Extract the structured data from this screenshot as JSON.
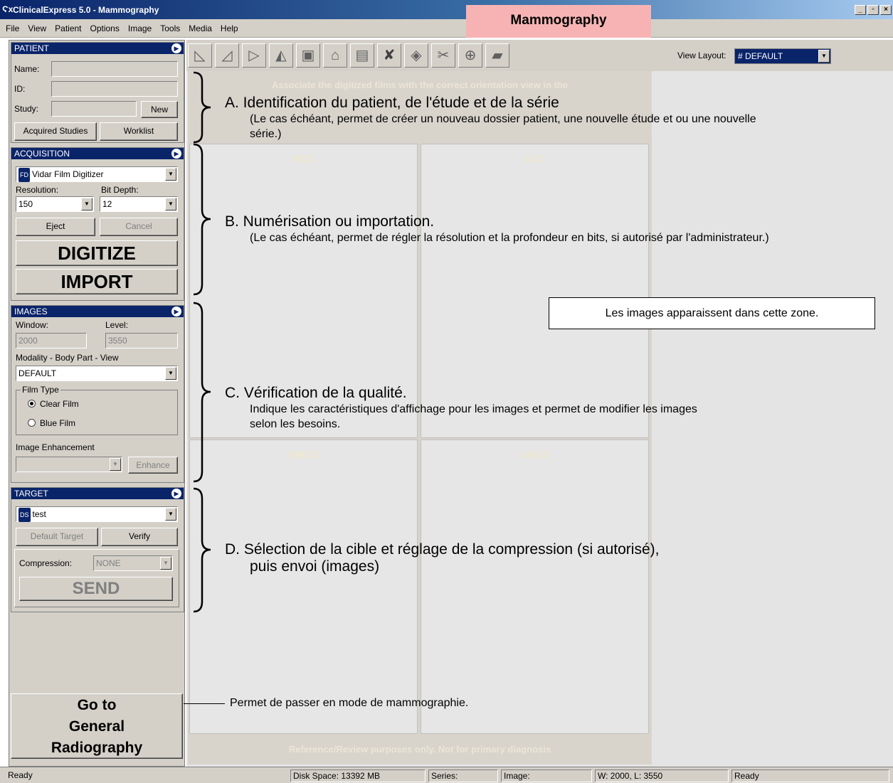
{
  "window": {
    "icon": "Ϛx",
    "title": "ClinicalExpress 5.0 - Mammography",
    "min": "_",
    "max": "▫",
    "close": "×"
  },
  "menu": [
    "File",
    "View",
    "Patient",
    "Options",
    "Image",
    "Tools",
    "Media",
    "Help"
  ],
  "mode_banner": "Mammography",
  "patient": {
    "header": "PATIENT",
    "name_label": "Name:",
    "id_label": "ID:",
    "study_label": "Study:",
    "new_button": "New",
    "acquired_button": "Acquired Studies",
    "worklist_button": "Worklist"
  },
  "acquisition": {
    "header": "ACQUISITION",
    "device_badge": "FD",
    "device": "Vidar Film Digitizer",
    "resolution_label": "Resolution:",
    "bitdepth_label": "Bit Depth:",
    "resolution": "150",
    "bitdepth": "12",
    "eject_button": "Eject",
    "cancel_button": "Cancel",
    "digitize_button": "DIGITIZE",
    "import_button": "IMPORT"
  },
  "images": {
    "header": "IMAGES",
    "window_label": "Window:",
    "level_label": "Level:",
    "window_value": "2000",
    "level_value": "3550",
    "modality_label": "Modality - Body Part - View",
    "modality_value": "DEFAULT",
    "filmtype_label": "Film Type",
    "clear_film": "Clear Film",
    "blue_film": "Blue Film",
    "enhancement_label": "Image Enhancement",
    "enhance_button": "Enhance"
  },
  "target": {
    "header": "TARGET",
    "target_badge": "DS",
    "target_value": "test",
    "default_target_button": "Default Target",
    "verify_button": "Verify",
    "compression_label": "Compression:",
    "compression_value": "NONE",
    "send_button": "SEND"
  },
  "goto_button": {
    "line1": "Go to",
    "line2": "General",
    "line3": "Radiography"
  },
  "toolbar": {
    "view_layout_label": "View Layout:",
    "view_layout_value": "DEFAULT",
    "tools": [
      "flip-left-icon",
      "flip-right-icon",
      "play-icon",
      "mirror-icon",
      "fit-icon",
      "home-icon",
      "page-icon",
      "delete-icon",
      "fill-icon",
      "cut-icon",
      "zoom-icon",
      "chat-icon"
    ]
  },
  "hanger": {
    "top_note_1": "Associate the digitized films with the correct orientation view in the",
    "vp_rcc": "RCC",
    "vp_lcc": "LCC",
    "vp_rmlo": "RMLO",
    "vp_lmlo": "LMLO",
    "bottom_note": "Reference/Review purposes only. Not for primary diagnosis"
  },
  "annotations": {
    "a_head": "A. Identification du patient, de l'étude et de la série",
    "a_sub": "(Le cas échéant, permet de créer un nouveau dossier patient, une nouvelle étude et ou une nouvelle série.)",
    "b_head": "B. Numérisation ou importation.",
    "b_sub": "(Le cas échéant, permet de régler la résolution et la profondeur en bits, si autorisé par l'administrateur.)",
    "c_head": "C. Vérification de la qualité.",
    "c_sub": "Indique les caractéristiques d'affichage pour les images et permet de modifier les images selon les besoins.",
    "d_head": "D. Sélection de la cible et réglage de la compression (si autorisé),",
    "d_head2": "puis envoi (images)",
    "images_zone": "Les images apparaissent dans cette zone.",
    "goto_callout": "Permet de passer en mode de mammographie."
  },
  "status": {
    "left": "Ready",
    "disk": "Disk Space: 13392 MB",
    "series": "Series:",
    "image": "Image:",
    "wl": "W: 2000, L: 3550",
    "right": "Ready"
  }
}
